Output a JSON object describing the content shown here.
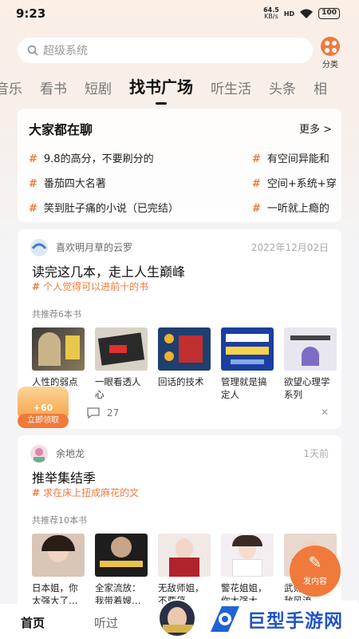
{
  "status_bar": {
    "time": "9:23",
    "net_speed": "64.5",
    "net_unit": "KB/s",
    "signal": "HD",
    "battery": "100"
  },
  "search": {
    "placeholder": "超级系统"
  },
  "category": {
    "label": "分类"
  },
  "tabs": [
    "音乐",
    "看书",
    "短剧",
    "找书广场",
    "听生活",
    "头条",
    "相"
  ],
  "active_tab": "找书广场",
  "discussion": {
    "title": "大家都在聊",
    "more": "更多 >",
    "topics_left": [
      "9.8的高分，不要刷分的",
      "番茄四大名著",
      "笑到肚子痛的小说（已完结）"
    ],
    "topics_right": [
      "有空间异能和",
      "空间+系统+穿",
      "一听就上瘾的"
    ]
  },
  "posts": [
    {
      "user": "喜欢明月草的云罗",
      "date": "2022年12月02日",
      "title": "读完这几本，走上人生巅峰",
      "tag": "个人觉得可以进前十的书",
      "count": "共推荐6本书",
      "books": [
        "人性的弱点",
        "一眼看透人心",
        "回话的技术",
        "管理就是搞定人",
        "欲望心理学系列"
      ],
      "comments": "27"
    },
    {
      "user": "余地龙",
      "date": "1天前",
      "title": "推举集结季",
      "tag": "求在床上扭成麻花的文",
      "count": "共推荐10本书",
      "books": [
        "日本姐，你太强大了…",
        "全家流放：我带着嫂…",
        "无敌师姐，不要停",
        "警花姐姐，你太强大了…",
        "武则天是无敌风流"
      ]
    }
  ],
  "reward": {
    "amount": "+60",
    "button": "立即领取"
  },
  "fab": {
    "label": "发内容"
  },
  "bottom_nav": {
    "home": "首页",
    "listened": "听过"
  },
  "watermark": {
    "text": "巨型手游网"
  },
  "colors": {
    "accent": "#f07a3c",
    "watermark": "#2255c4"
  }
}
